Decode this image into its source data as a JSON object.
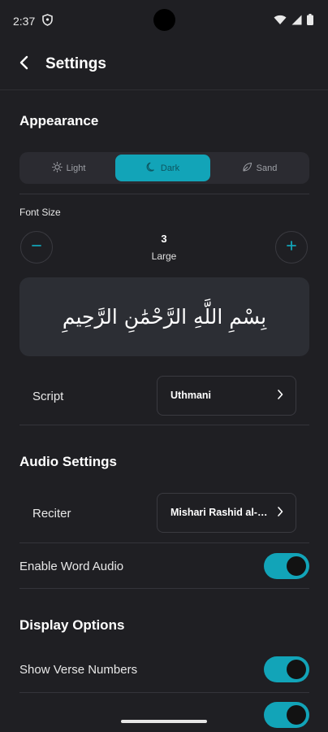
{
  "status_bar": {
    "time": "2:37",
    "icons": [
      "shield-icon",
      "wifi-icon",
      "signal-icon",
      "battery-icon"
    ]
  },
  "header": {
    "title": "Settings",
    "back_icon": "chevron-left-icon"
  },
  "appearance": {
    "title": "Appearance",
    "themes": [
      {
        "label": "Light",
        "icon": "sun-icon",
        "selected": false
      },
      {
        "label": "Dark",
        "icon": "moon-icon",
        "selected": true
      },
      {
        "label": "Sand",
        "icon": "leaf-icon",
        "selected": false
      }
    ],
    "font_size": {
      "label": "Font Size",
      "value": "3",
      "name": "Large"
    },
    "preview_text": "بِسْمِ اللَّهِ الرَّحْمَٰنِ الرَّحِيمِ",
    "script": {
      "label": "Script",
      "value": "Uthmani"
    }
  },
  "audio": {
    "title": "Audio Settings",
    "reciter": {
      "label": "Reciter",
      "value": "Mishari Rashid al-Afasy"
    },
    "word_audio": {
      "label": "Enable Word Audio",
      "enabled": true
    }
  },
  "display": {
    "title": "Display Options",
    "verse_numbers": {
      "label": "Show Verse Numbers",
      "enabled": true
    },
    "next_toggle": {
      "enabled": true
    }
  },
  "colors": {
    "accent": "#12a4b8",
    "background": "#1f1f23",
    "card": "#2c2e34"
  }
}
